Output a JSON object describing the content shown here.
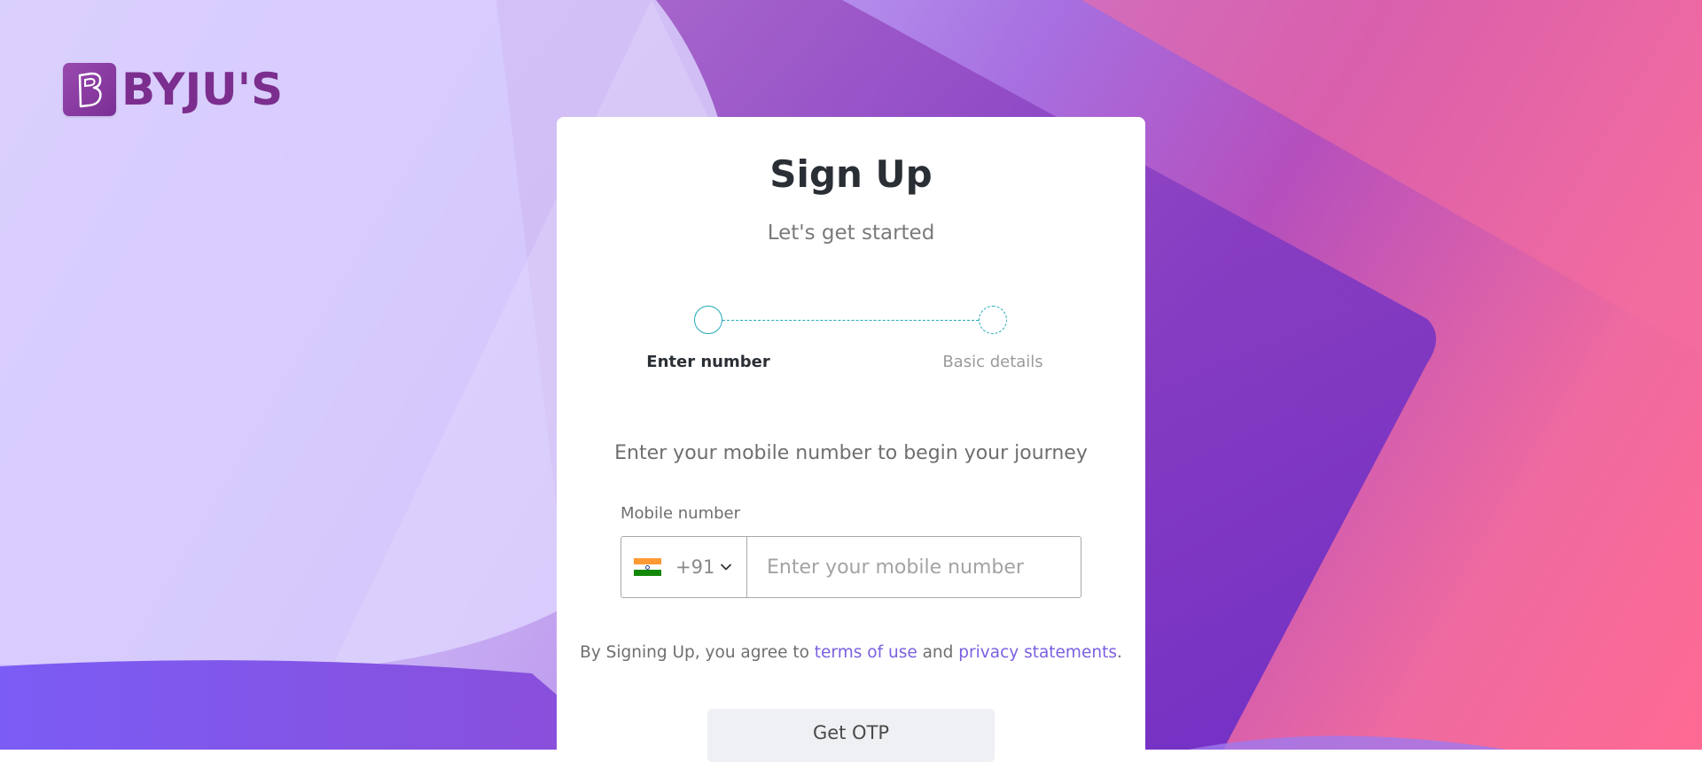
{
  "brand": {
    "name": "BYJU'S",
    "logo_letter": "B",
    "colors": {
      "logo": "#7b2e8e",
      "accent_teal": "#21a9b6",
      "link": "#7c5fe0"
    }
  },
  "signup": {
    "title": "Sign Up",
    "subtitle": "Let's get started",
    "steps": [
      {
        "label": "Enter number",
        "state": "active"
      },
      {
        "label": "Basic details",
        "state": "pending"
      }
    ],
    "intro": "Enter your mobile number to begin your journey",
    "mobile": {
      "label": "Mobile number",
      "country_flag": "india-flag-icon",
      "dial_code": "+91",
      "value": "",
      "placeholder": "Enter your mobile number"
    },
    "terms": {
      "prefix": "By Signing Up, you agree to ",
      "terms_link": "terms of use",
      "middle": " and ",
      "privacy_link": "privacy statements",
      "suffix": "."
    },
    "submit_label": "Get OTP"
  }
}
